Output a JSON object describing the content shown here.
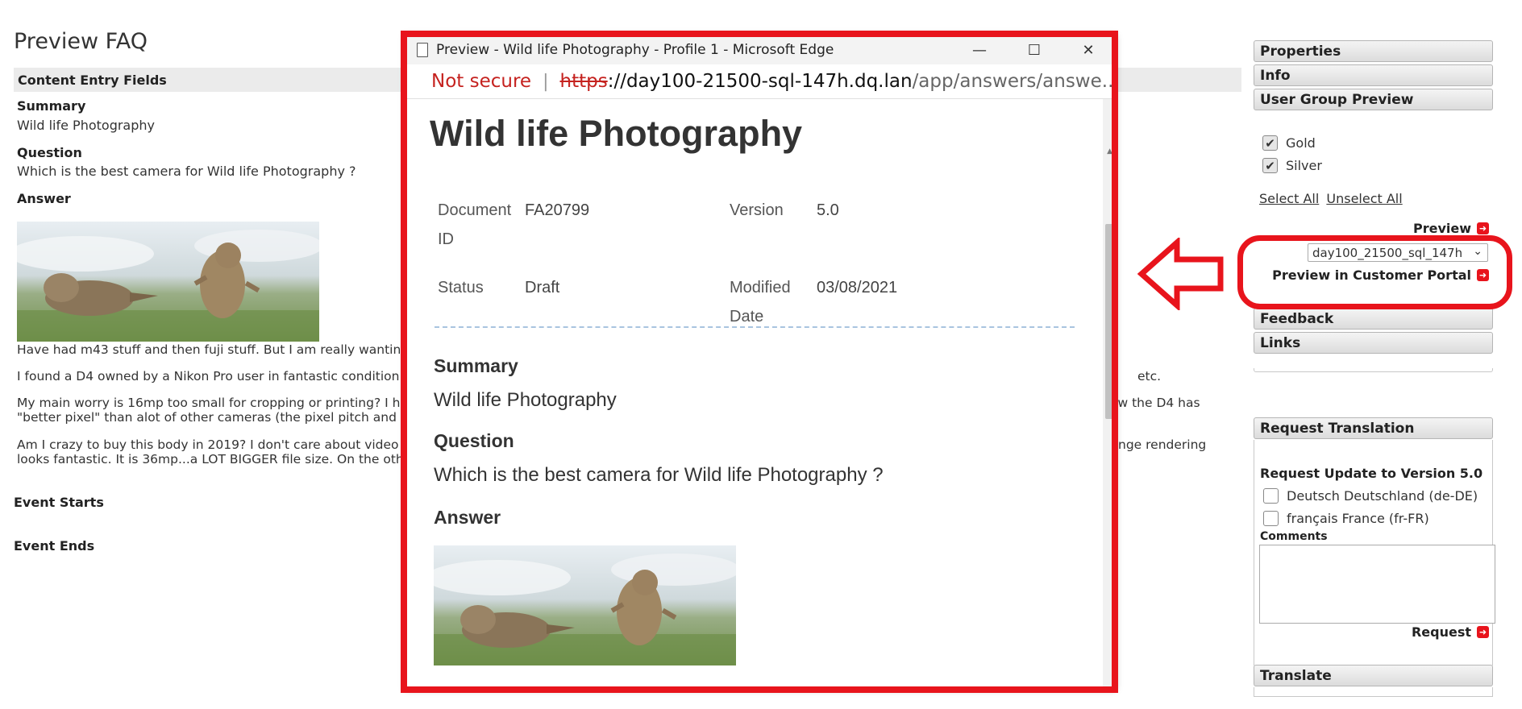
{
  "faq": {
    "title": "Preview FAQ",
    "section_header": "Content Entry Fields",
    "summary_label": "Summary",
    "summary_value": "Wild life Photography",
    "question_label": "Question",
    "question_value": "Which is the best camera for Wild life Photography ?",
    "answer_label": "Answer",
    "paragraphs": [
      "Have had m43 stuff and then fuji stuff. But I am really wanting t",
      "I found a D4 owned by a Nikon Pro user in fantastic condition wi",
      "My main worry is 16mp too small for cropping or printing? I hav",
      "\"better pixel\" than alot of other cameras (the pixel pitch and ot",
      "Am I crazy to buy this body in 2019? I don't care about video a",
      "looks fantastic. It is 36mp...a LOT BIGGER file size. On the oth"
    ],
    "paragraph_right_fragments": [
      "etc.",
      "ow the D4 has",
      "nge rendering"
    ],
    "event_starts_label": "Event Starts",
    "event_ends_label": "Event Ends"
  },
  "sidebar": {
    "properties": "Properties",
    "info": "Info",
    "user_group_preview": "User Group Preview",
    "groups": [
      {
        "label": "Gold",
        "checked": true
      },
      {
        "label": "Silver",
        "checked": true
      }
    ],
    "select_all": "Select All",
    "unselect_all": "Unselect All",
    "preview": "Preview",
    "portal_select_value": "day100_21500_sql_147h",
    "preview_customer_portal": "Preview in Customer Portal",
    "feedback": "Feedback",
    "links": "Links",
    "request_translation": "Request Translation",
    "request_update": "Request Update to Version 5.0",
    "languages": [
      {
        "label": "Deutsch Deutschland (de-DE)",
        "checked": false
      },
      {
        "label": "français France (fr-FR)",
        "checked": false
      }
    ],
    "comments_label": "Comments",
    "request": "Request",
    "translate": "Translate"
  },
  "popup": {
    "window_title": "Preview - Wild life Photography - Profile 1 - Microsoft Edge",
    "not_secure": "Not secure",
    "url_scheme": "https",
    "url_host": "://day100-21500-sql-147h.dq.lan",
    "url_path": "/app/answers/answe...",
    "doc_title": "Wild life Photography",
    "document_id_label_1": "Document",
    "document_id_label_2": "ID",
    "document_id": "FA20799",
    "version_label": "Version",
    "version": "5.0",
    "status_label": "Status",
    "status": "Draft",
    "modified_label_1": "Modified",
    "modified_label_2": "Date",
    "modified_date": "03/08/2021",
    "summary_label": "Summary",
    "summary_value": "Wild life Photography",
    "question_label": "Question",
    "question_value": "Which is the best camera for Wild life Photography ?",
    "answer_label": "Answer"
  },
  "colors": {
    "annotation_red": "#e8141c",
    "not_secure_red": "#c5221f",
    "dashed_separator": "#a9c4e0"
  }
}
